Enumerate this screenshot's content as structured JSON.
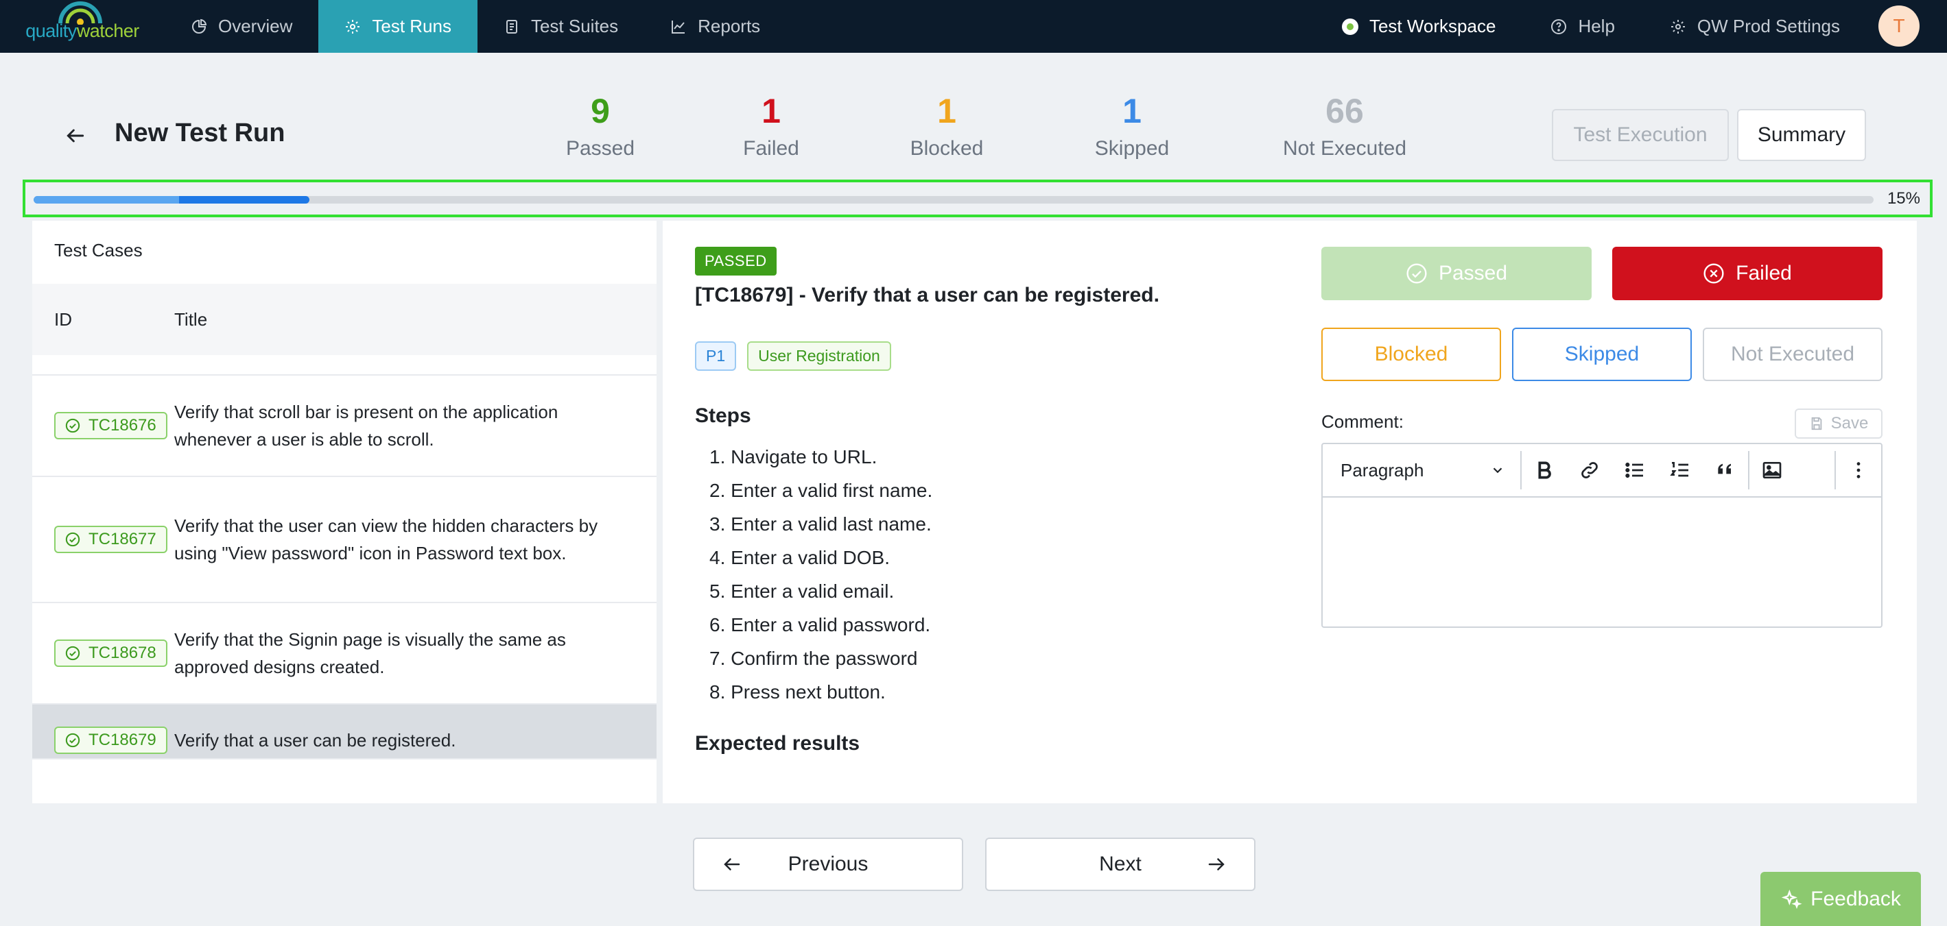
{
  "nav": {
    "logo_left": "quality",
    "logo_right": "watcher",
    "items": [
      {
        "label": "Overview",
        "icon": "pie-chart-icon"
      },
      {
        "label": "Test Runs",
        "icon": "gear-icon"
      },
      {
        "label": "Test Suites",
        "icon": "document-icon"
      },
      {
        "label": "Reports",
        "icon": "line-chart-icon"
      }
    ],
    "workspace": "Test Workspace",
    "help": "Help",
    "settings": "QW Prod Settings",
    "avatar_initial": "T"
  },
  "header": {
    "title": "New Test Run",
    "stats": [
      {
        "value": "9",
        "label": "Passed",
        "color": "#3e9e1a"
      },
      {
        "value": "1",
        "label": "Failed",
        "color": "#d0111d"
      },
      {
        "value": "1",
        "label": "Blocked",
        "color": "#f0a51d"
      },
      {
        "value": "1",
        "label": "Skipped",
        "color": "#3c8ae6"
      },
      {
        "value": "66",
        "label": "Not Executed",
        "color": "#b3b9c0"
      }
    ],
    "test_execution_label": "Test Execution",
    "summary_label": "Summary"
  },
  "progress": {
    "percent_label": "15%",
    "fraction": 0.15
  },
  "test_cases": {
    "panel_title": "Test Cases",
    "col_id": "ID",
    "col_title": "Title",
    "rows": [
      {
        "id": "TC18676",
        "title": "Verify that scroll bar is present on the application whenever a user is able to scroll."
      },
      {
        "id": "TC18677",
        "title": "Verify that the user can view the hidden characters by using \"View password\" icon in Password text box."
      },
      {
        "id": "TC18678",
        "title": "Verify that the Signin page is visually the same as approved designs created."
      },
      {
        "id": "TC18679",
        "title": "Verify that a user can be registered."
      }
    ]
  },
  "detail": {
    "status": "PASSED",
    "heading": "[TC18679] - Verify that a user can be registered.",
    "tags": [
      "P1",
      "User Registration"
    ],
    "steps_title": "Steps",
    "steps": [
      "1. Navigate to URL.",
      "2. Enter a valid first name.",
      "3. Enter a valid last name.",
      "4. Enter a valid DOB.",
      "5. Enter a valid email.",
      "6. Enter a valid password.",
      "7. Confirm the password",
      "8. Press next button."
    ],
    "expected_title": "Expected results"
  },
  "actions": {
    "passed": "Passed",
    "failed": "Failed",
    "blocked": "Blocked",
    "skipped": "Skipped",
    "not_executed": "Not Executed"
  },
  "comment": {
    "label": "Comment:",
    "save": "Save",
    "paragraph": "Paragraph"
  },
  "footer": {
    "previous": "Previous",
    "next": "Next",
    "feedback": "Feedback"
  }
}
